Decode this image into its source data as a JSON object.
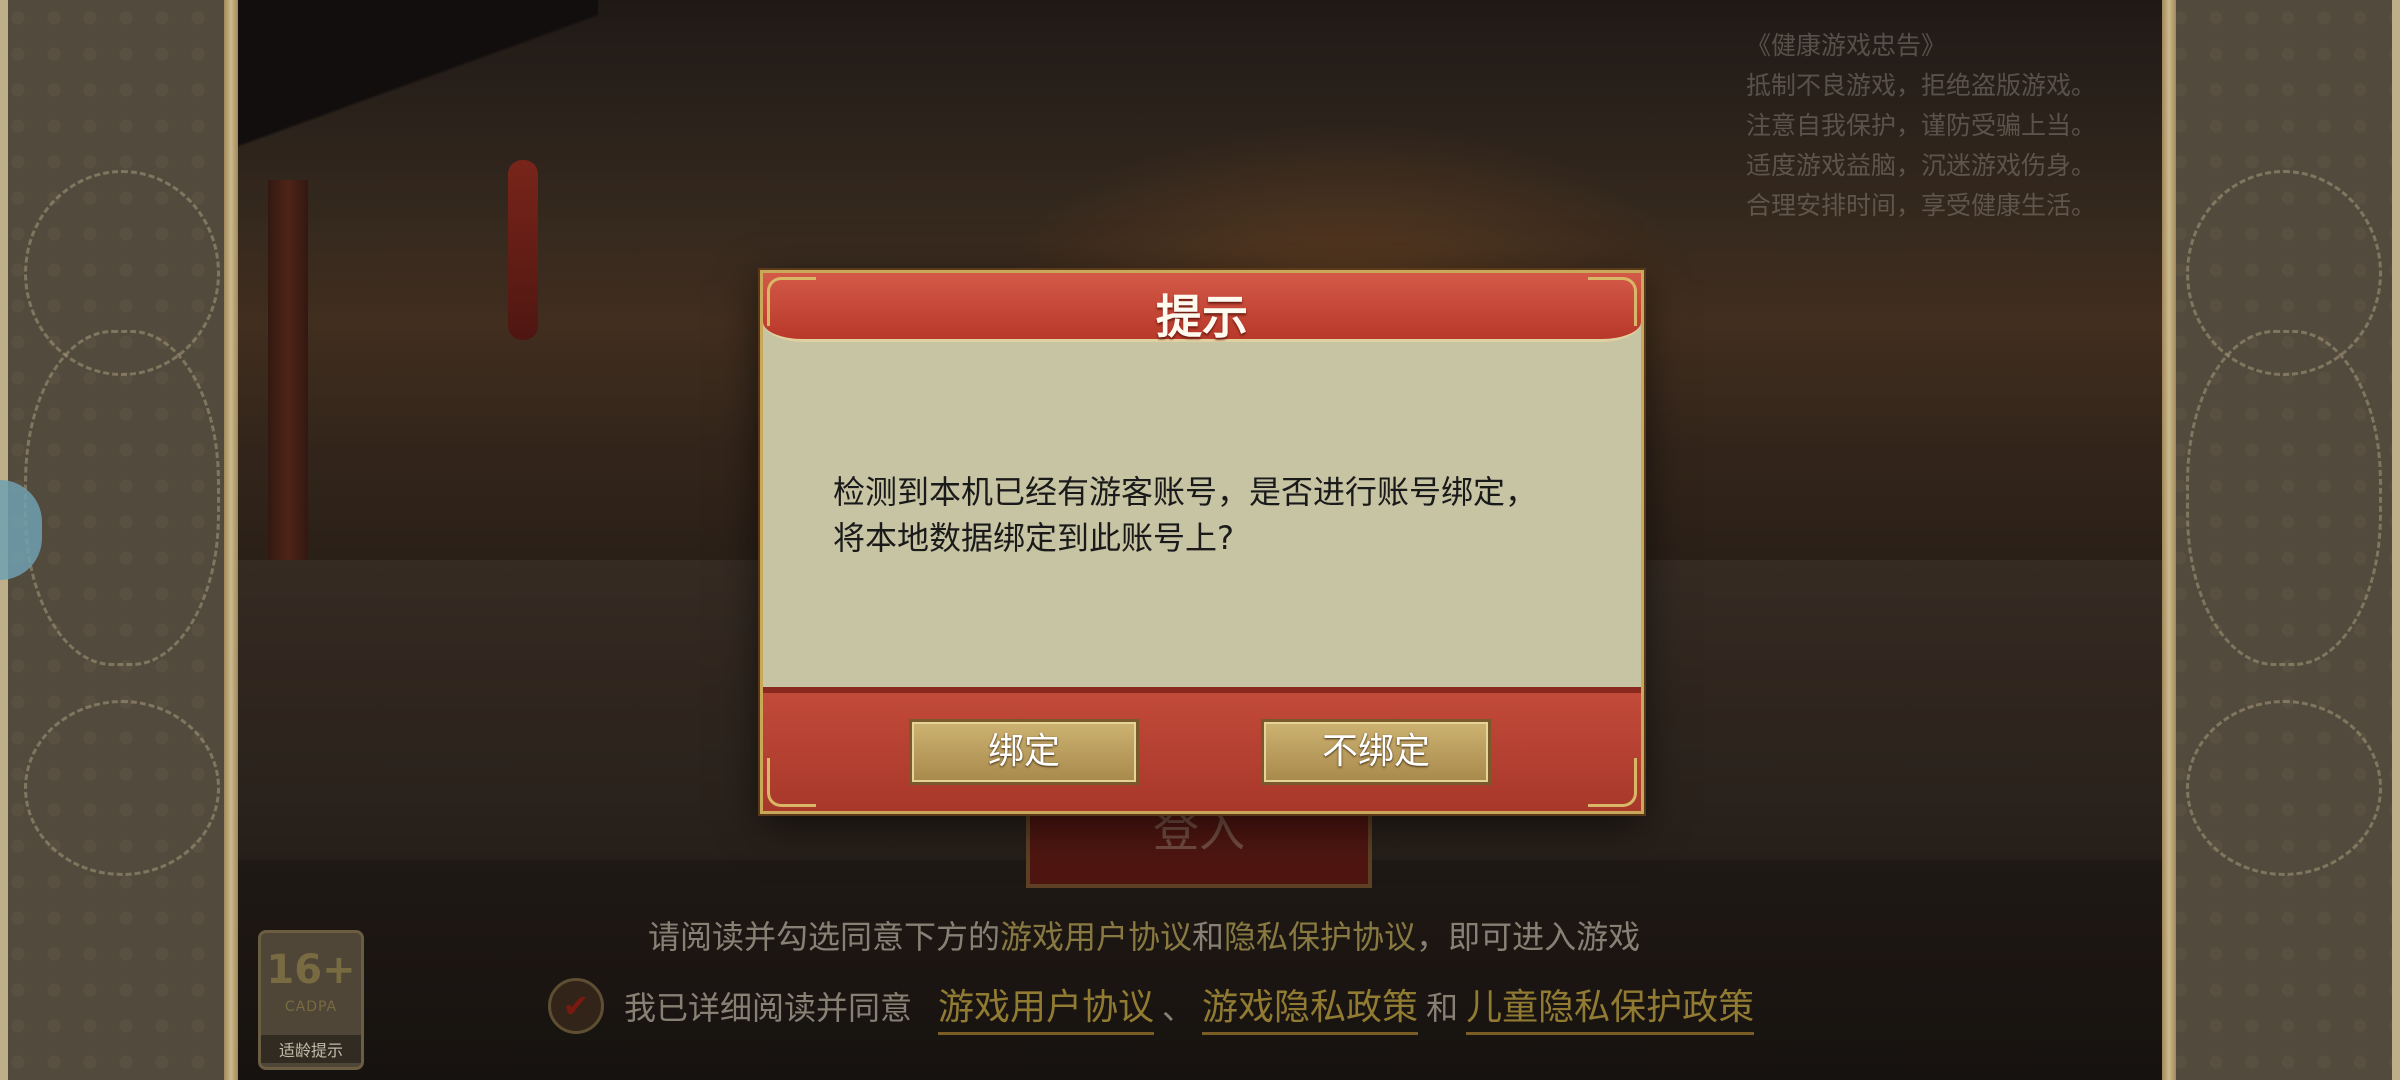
{
  "health_notice": {
    "title": "《健康游戏忠告》",
    "lines": [
      "抵制不良游戏，拒绝盗版游戏。",
      "注意自我保护，谨防受骗上当。",
      "适度游戏益脑，沉迷游戏伤身。",
      "合理安排时间，享受健康生活。"
    ]
  },
  "background": {
    "login_button_label": "登入"
  },
  "agreement": {
    "notice_prefix": "请阅读并勾选同意下方的",
    "notice_link1": "游戏用户协议",
    "notice_and": "和",
    "notice_link2": "隐私保护协议",
    "notice_suffix": "，即可进入游戏",
    "agree_text": "我已详细阅读并同意",
    "link_user_agreement": "游戏用户协议",
    "sep": "、",
    "link_privacy_policy": "游戏隐私政策",
    "and": "和",
    "link_child_privacy": "儿童隐私保护政策"
  },
  "age_rating": {
    "age": "16+",
    "org": "CADPA",
    "label": "适龄提示"
  },
  "dialog": {
    "title": "提示",
    "message": "检测到本机已经有游客账号，是否进行账号绑定，将本地数据绑定到此账号上?",
    "bind_label": "绑定",
    "no_bind_label": "不绑定"
  }
}
